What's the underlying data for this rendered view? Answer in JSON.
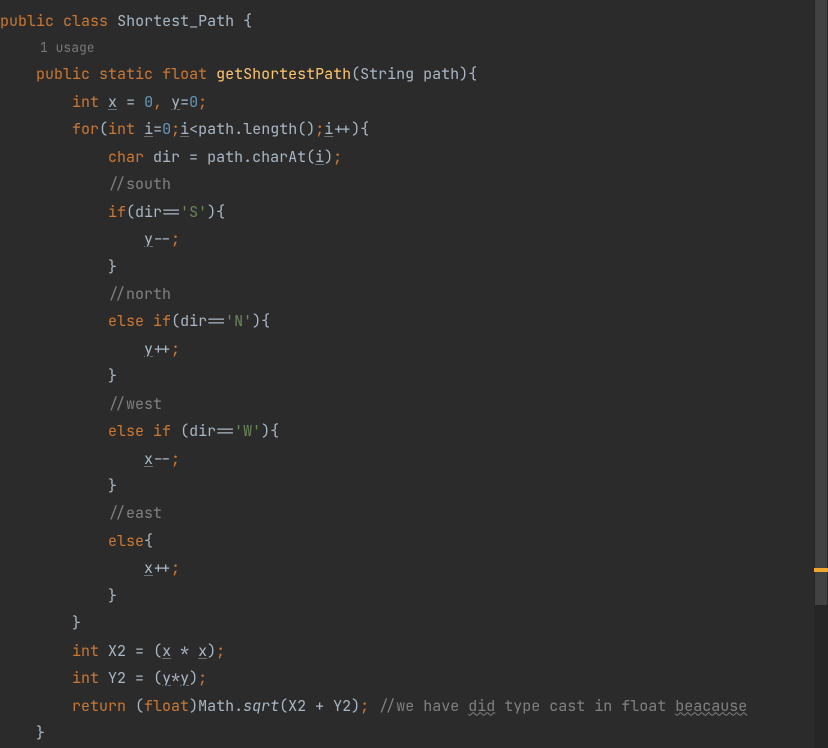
{
  "code": {
    "l1": {
      "kw1": "public",
      "kw2": "class",
      "name": "Shortest_Path",
      "brace": " {"
    },
    "usage": "1 usage",
    "l2": {
      "kw1": "public",
      "kw2": "static",
      "kw3": "float",
      "method": "getShortestPath",
      "paren1": "(",
      "ptype": "String ",
      "pname": "path",
      "paren2": ")",
      "brace": "{"
    },
    "l3": {
      "kw": "int",
      "v1": "x",
      "eq": " = ",
      "n1": "0",
      "comma": ", ",
      "v2": "y",
      "eq2": "=",
      "n2": "0",
      "semi": ";"
    },
    "l4": {
      "kw1": "for",
      "paren": "(",
      "kw2": "int",
      "v1": "i",
      "eq": "=",
      "n1": "0",
      "semi1": ";",
      "v2": "i",
      "lt": "<",
      "path": "path",
      "dot": ".",
      "method": "length",
      "parens": "()",
      "semi2": ";",
      "v3": "i",
      "inc": "++",
      "paren2": ")",
      "brace": "{"
    },
    "l5": {
      "kw": "char",
      "dir": " dir ",
      "eq": "= ",
      "path": "path",
      "dot": ".",
      "method": "charAt",
      "paren1": "(",
      "v": "i",
      "paren2": ")",
      "semi": ";"
    },
    "l6": "//south",
    "l7": {
      "kw": "if",
      "paren1": "(",
      "dir": "dir",
      "eq": "==",
      "char": "'S'",
      "paren2": ")",
      "brace": "{"
    },
    "l8": {
      "v": "y",
      "op": "--",
      "semi": ";"
    },
    "l9": "}",
    "l10": "//north",
    "l11": {
      "kw1": "else",
      "kw2": "if",
      "paren1": "(",
      "dir": "dir",
      "eq": "==",
      "char": "'N'",
      "paren2": ")",
      "brace": "{"
    },
    "l12": {
      "v": "y",
      "op": "++",
      "semi": ";"
    },
    "l13": "}",
    "l14": "//west",
    "l15": {
      "kw1": "else",
      "kw2": "if",
      "paren1": " (",
      "dir": "dir",
      "eq": "==",
      "char": "'W'",
      "paren2": ")",
      "brace": "{"
    },
    "l16": {
      "v": "x",
      "op": "--",
      "semi": ";"
    },
    "l17": "}",
    "l18": "//east",
    "l19": {
      "kw": "else",
      "brace": "{"
    },
    "l20": {
      "v": "x",
      "op": "++",
      "semi": ";"
    },
    "l21": "}",
    "l22": "}",
    "l23": {
      "kw": "int",
      "v": " X2 ",
      "eq": "= ",
      "paren1": "(",
      "x1": "x",
      "mul": " * ",
      "x2": "x",
      "paren2": ")",
      "semi": ";"
    },
    "l24": {
      "kw": "int",
      "v": " Y2 ",
      "eq": "= ",
      "paren1": "(",
      "y1": "y",
      "mul": "*",
      "y2": "y",
      "paren2": ")",
      "semi": ";"
    },
    "l25": {
      "kw1": "return",
      "paren1": " (",
      "kw2": "float",
      "paren2": ")",
      "math": "Math",
      "dot": ".",
      "sqrt": "sqrt",
      "paren3": "(",
      "expr": "X2 + Y2",
      "paren4": ")",
      "semi": ";",
      "sp": " ",
      "c1": "//we have ",
      "did": "did",
      "c2": " type cast in float ",
      "beacause": "beacause"
    },
    "l26": "}"
  }
}
